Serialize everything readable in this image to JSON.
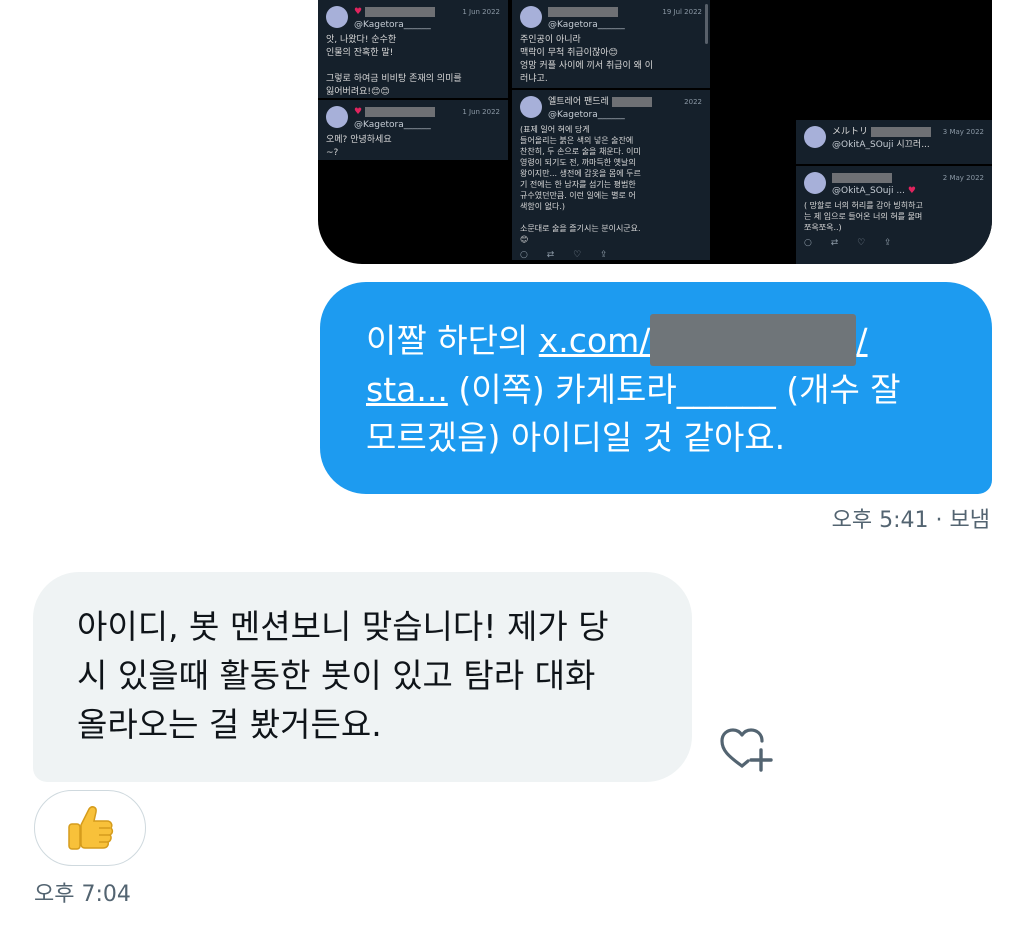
{
  "thread_image": {
    "cards": [
      {
        "date": "1 Jun 2022",
        "handle": "@Kagetora______",
        "text": "앗, 나왔다! 순수한\n인물의 잔혹한 말!\n\n그렇로 하여금 비비탕 존재의 의미를\n잃어버려요!😊😊"
      },
      {
        "date": "1 Jun 2022",
        "handle": "@Kagetora______",
        "text": "오메? 안녕하세요\n~?"
      },
      {
        "date": "19 Jul 2022",
        "handle": "@Kagetora______",
        "text": "주인공이 아니라\n맥락이 무척 취급이잖아😊\n엉망 커플 사이에 끼서 취급이 왜 이\n러냐고."
      },
      {
        "date": "2022",
        "name": "엘트레어 팬드레",
        "handle": "@Kagetora______",
        "text": "(표제 일어 혀에 당게\n들어올리는 붉은 색의 넣은 술잔에\n찬찬히, 두 손으로 술을 채운다. 이미\n영령이 되기도 전, 까마득한 옛날의\n왕이지만... 생전에 갑옷을 몸에 두르\n기 전에는 한 남자를 섬기는 평범한\n규수였던만큼. 이런 일에는 별로 어\n색함이 없다.)\n\n소문대로 술을 즐기시는 분이시군요.\n😊"
      },
      {
        "date": "3 May 2022",
        "name": "メルトリ",
        "handle": "@OkitA_SOuji",
        "text": "시끄러..."
      },
      {
        "date": "2 May 2022",
        "handle": "@OkitA_SOuji ...",
        "text": "( 망할로 너의 허리를 감아 빙히하고\n는 제 입으로 들어온 너의 혀를 물며\n쪼옥쪼옥..)"
      }
    ]
  },
  "sent_message": {
    "line1_prefix": "이짤 하단의 ",
    "link_start": "x.com/",
    "link_end": "/",
    "link_line2": "sta...",
    "line2_rest": " (이쪽) 카게토라______ (개수 잘",
    "line3": "모르겠음) 아이디일 것 같아요.",
    "time": "오후 5:41",
    "status": "· 보냄"
  },
  "received_message": {
    "line1": "아이디, 봇 멘션보니 맞습니다! 제가 당",
    "line2": "시 있을때 활동한 봇이 있고 탐라 대화",
    "line3": "올라오는 걸 봤거든요.",
    "reaction_emoji": "👍",
    "time": "오후 7:04"
  },
  "icons": {
    "react": "heart-plus-icon",
    "thumbs": "thumbs-up-icon"
  },
  "colors": {
    "sent_bubble": "#1d9bf0",
    "received_bubble": "#eff3f4",
    "meta_text": "#536471",
    "image_bg": "#000000",
    "card_bg": "#15202b"
  }
}
